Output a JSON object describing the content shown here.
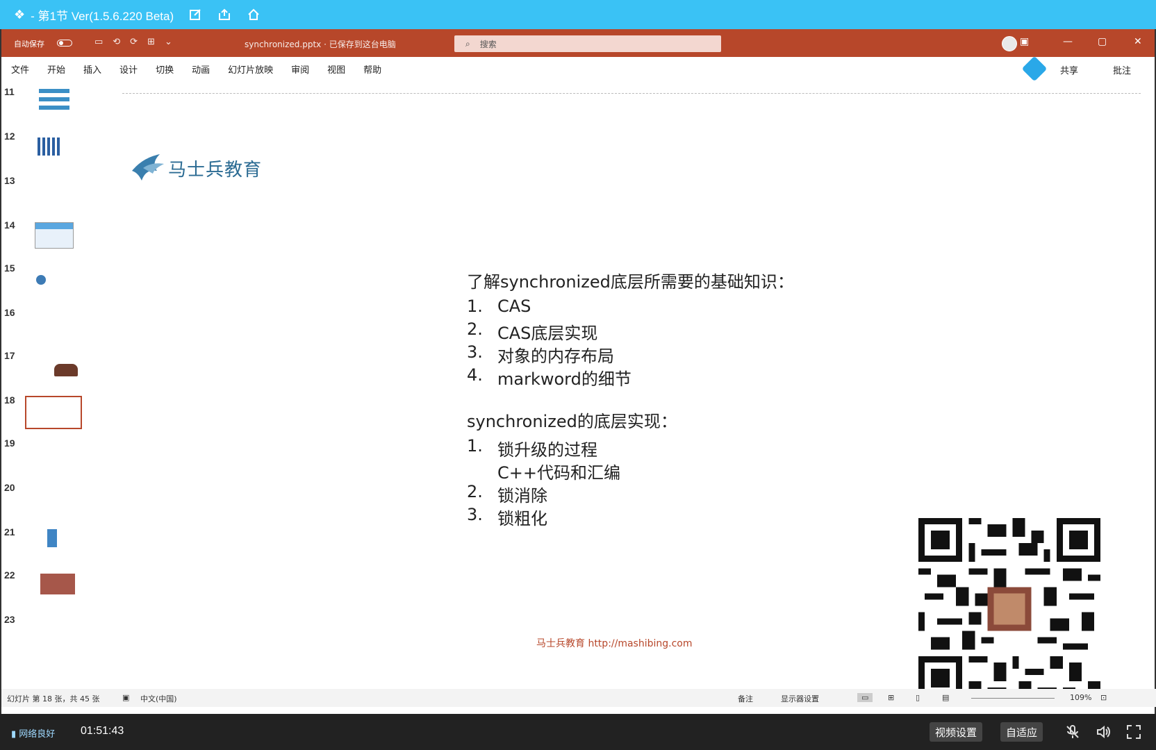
{
  "player": {
    "title": "- 第1节 Ver(1.5.6.220 Beta)",
    "net_status": "网络良好",
    "time": "01:51:43",
    "video_settings_label": "视频设置",
    "adaptive_label": "自适应"
  },
  "ppt": {
    "autosave_label": "自动保存",
    "filename": "synchronized.pptx · 已保存到这台电脑",
    "search_placeholder": "搜索",
    "tabs": [
      "文件",
      "开始",
      "插入",
      "设计",
      "切换",
      "动画",
      "幻灯片放映",
      "审阅",
      "视图",
      "帮助"
    ],
    "share_label": "共享",
    "comment_label": "批注"
  },
  "thumbnails": {
    "numbers": [
      "11",
      "12",
      "13",
      "14",
      "15",
      "16",
      "17",
      "18",
      "19",
      "20",
      "21",
      "22",
      "23"
    ],
    "selected": "18"
  },
  "slide": {
    "brand": "马士兵教育",
    "heading1": "了解synchronized底层所需要的基础知识：",
    "list1": [
      {
        "n": "1.",
        "text": "CAS"
      },
      {
        "n": "2.",
        "text": "CAS底层实现"
      },
      {
        "n": "3.",
        "text": "对象的内存布局"
      },
      {
        "n": "4.",
        "text": "markword的细节"
      }
    ],
    "heading2": "synchronized的底层实现：",
    "list2": [
      {
        "n": "1.",
        "text": "锁升级的过程"
      },
      {
        "n": "",
        "text": "C++代码和汇编"
      },
      {
        "n": "2.",
        "text": "锁消除"
      },
      {
        "n": "3.",
        "text": "锁粗化"
      }
    ],
    "footer": "马士兵教育 http://mashibing.com"
  },
  "status": {
    "slide_info": "幻灯片 第 18 张，共 45 张",
    "language": "中文(中国)",
    "notes_label": "备注",
    "display_label": "显示器设置",
    "zoom": "109%"
  },
  "colors": {
    "player_bar": "#3ac2f5",
    "ppt_accent": "#b7472a"
  }
}
